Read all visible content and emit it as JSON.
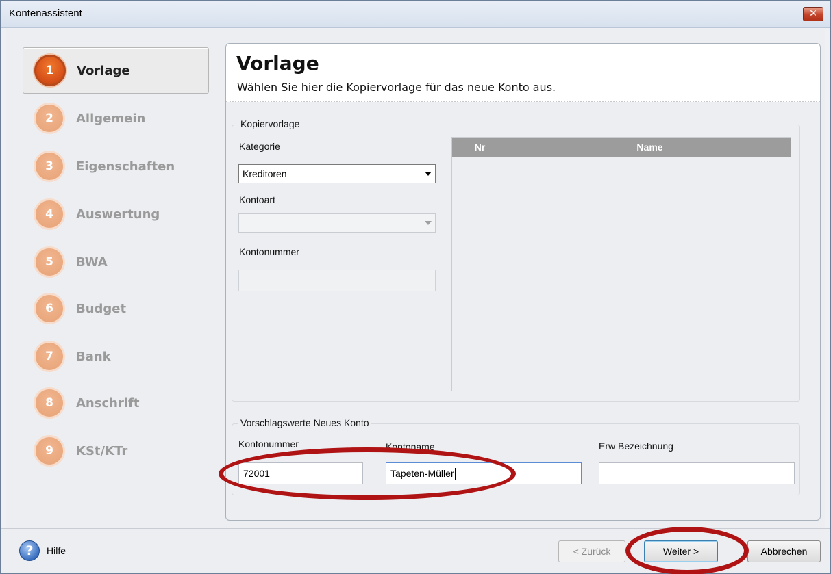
{
  "window": {
    "title": "Kontenassistent",
    "close_glyph": "✕"
  },
  "steps": [
    {
      "number": "1",
      "label": "Vorlage",
      "active": true
    },
    {
      "number": "2",
      "label": "Allgemein",
      "active": false
    },
    {
      "number": "3",
      "label": "Eigenschaften",
      "active": false
    },
    {
      "number": "4",
      "label": "Auswertung",
      "active": false
    },
    {
      "number": "5",
      "label": "BWA",
      "active": false
    },
    {
      "number": "6",
      "label": "Budget",
      "active": false
    },
    {
      "number": "7",
      "label": "Bank",
      "active": false
    },
    {
      "number": "8",
      "label": "Anschrift",
      "active": false
    },
    {
      "number": "9",
      "label": "KSt/KTr",
      "active": false
    }
  ],
  "header": {
    "title": "Vorlage",
    "subtitle": "Wählen Sie hier die Kopiervorlage für das neue Konto aus."
  },
  "kopiervorlage": {
    "legend": "Kopiervorlage",
    "kategorie_label": "Kategorie",
    "kategorie_value": "Kreditoren",
    "kontoart_label": "Kontoart",
    "kontoart_value": "",
    "kontonummer_label": "Kontonummer",
    "kontonummer_value": "",
    "table": {
      "columns": [
        "Nr",
        "Name"
      ],
      "rows": []
    }
  },
  "vorschlag": {
    "legend": "Vorschlagswerte Neues Konto",
    "kontonummer_label": "Kontonummer",
    "kontonummer_value": "72001",
    "kontoname_label": "Kontoname",
    "kontoname_value": "Tapeten-Müller",
    "erw_label": "Erw Bezeichnung",
    "erw_value": ""
  },
  "footer": {
    "help_glyph": "?",
    "help_label": "Hilfe",
    "back_label": "< Zurück",
    "next_label": "Weiter >",
    "cancel_label": "Abbrechen"
  },
  "colors": {
    "active_step": "#d9531a",
    "inactive_step": "#ebaa80",
    "annotation": "#b01313",
    "table_header": "#9c9c9c"
  }
}
